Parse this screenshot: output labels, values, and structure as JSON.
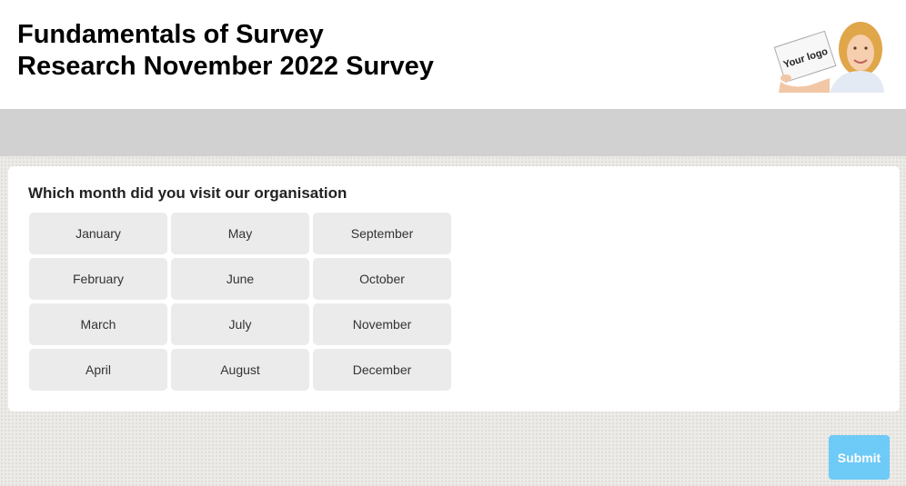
{
  "header": {
    "title_line1": "Fundamentals of Survey",
    "title_line2": "Research November 2022 Survey",
    "logo_text": "Your logo"
  },
  "question": {
    "text": "Which month did you visit our organisation",
    "options": [
      [
        "January",
        "May",
        "September"
      ],
      [
        "February",
        "June",
        "October"
      ],
      [
        "March",
        "July",
        "November"
      ],
      [
        "April",
        "August",
        "December"
      ]
    ]
  },
  "submit": {
    "label": "Submit"
  },
  "colors": {
    "grey_bar": "#d1d1d1",
    "option_bg": "#ebebeb",
    "submit_bg": "#6ecaf6"
  }
}
